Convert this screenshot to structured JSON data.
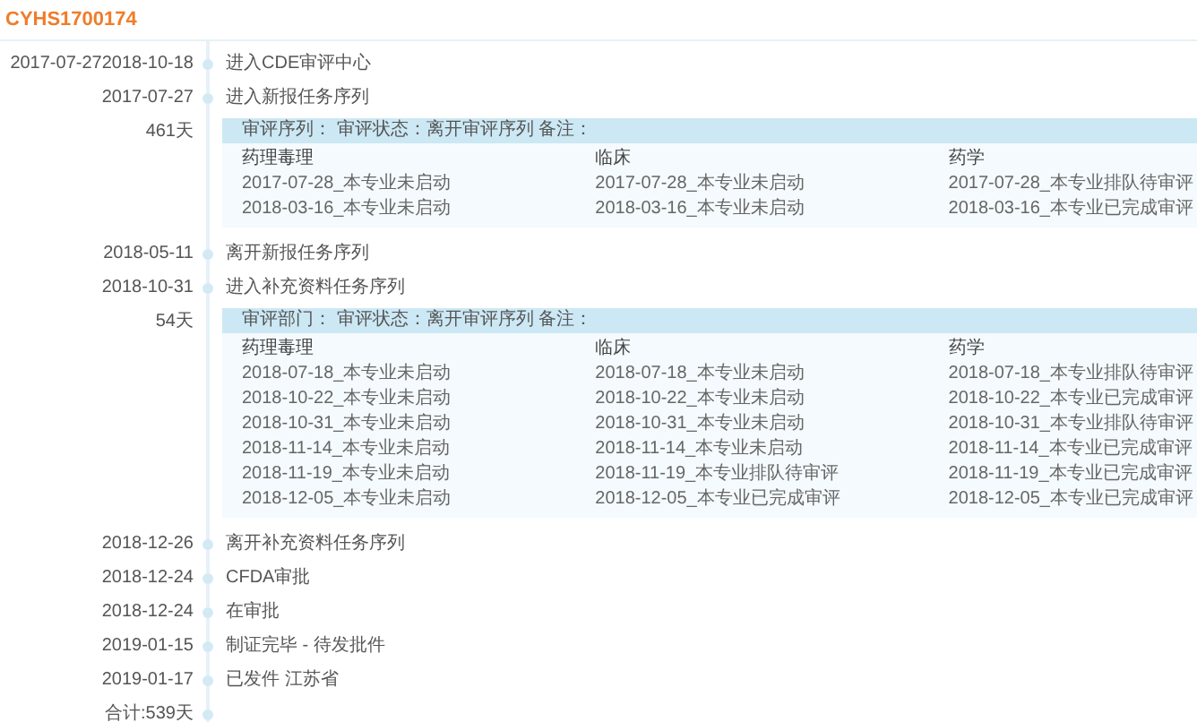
{
  "title": "CYHS1700174",
  "timeline": [
    {
      "kind": "event",
      "label": "2017-07-272018-10-18",
      "text": "进入CDE审评中心"
    },
    {
      "kind": "event",
      "label": "2017-07-27",
      "text": "进入新报任务序列"
    },
    {
      "kind": "review",
      "label": "461天",
      "header": "审评序列： 审评状态：离开审评序列 备注：",
      "columns": [
        "药理毒理",
        "临床",
        "药学"
      ],
      "rows": [
        [
          "2017-07-28_本专业未启动",
          "2017-07-28_本专业未启动",
          "2017-07-28_本专业排队待审评"
        ],
        [
          "2018-03-16_本专业未启动",
          "2018-03-16_本专业未启动",
          "2018-03-16_本专业已完成审评"
        ]
      ]
    },
    {
      "kind": "event",
      "label": "2018-05-11",
      "text": "离开新报任务序列"
    },
    {
      "kind": "event",
      "label": "2018-10-31",
      "text": "进入补充资料任务序列"
    },
    {
      "kind": "review",
      "label": "54天",
      "header": "审评部门： 审评状态：离开审评序列 备注：",
      "columns": [
        "药理毒理",
        "临床",
        "药学"
      ],
      "rows": [
        [
          "2018-07-18_本专业未启动",
          "2018-07-18_本专业未启动",
          "2018-07-18_本专业排队待审评"
        ],
        [
          "2018-10-22_本专业未启动",
          "2018-10-22_本专业未启动",
          "2018-10-22_本专业已完成审评"
        ],
        [
          "2018-10-31_本专业未启动",
          "2018-10-31_本专业未启动",
          "2018-10-31_本专业排队待审评"
        ],
        [
          "2018-11-14_本专业未启动",
          "2018-11-14_本专业未启动",
          "2018-11-14_本专业已完成审评"
        ],
        [
          "2018-11-19_本专业未启动",
          "2018-11-19_本专业排队待审评",
          "2018-11-19_本专业已完成审评"
        ],
        [
          "2018-12-05_本专业未启动",
          "2018-12-05_本专业已完成审评",
          "2018-12-05_本专业已完成审评"
        ]
      ]
    },
    {
      "kind": "event",
      "label": "2018-12-26",
      "text": "离开补充资料任务序列"
    },
    {
      "kind": "event",
      "label": "2018-12-24",
      "text": "CFDA审批"
    },
    {
      "kind": "event",
      "label": "2018-12-24",
      "text": "在审批"
    },
    {
      "kind": "event",
      "label": "2019-01-15",
      "text": "制证完毕 - 待发批件"
    },
    {
      "kind": "event",
      "label": "2019-01-17",
      "text": "已发件 江苏省"
    },
    {
      "kind": "total",
      "label": "合计:539天"
    }
  ]
}
